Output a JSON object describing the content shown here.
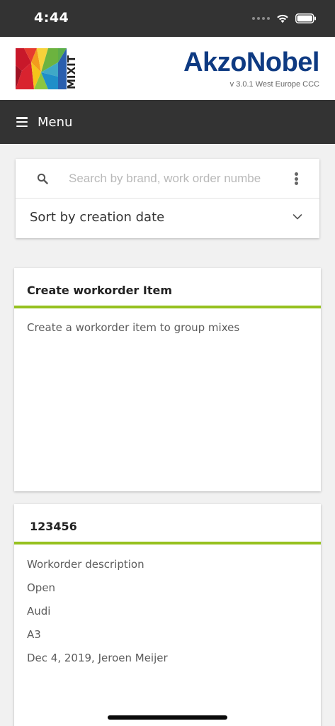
{
  "status_bar": {
    "time": "4:44"
  },
  "header": {
    "brand_logo_text": "MIXIT",
    "company_logo_text": "AkzoNobel",
    "version": "v 3.0.1 West Europe CCC"
  },
  "menu": {
    "label": "Menu"
  },
  "search": {
    "placeholder": "Search by brand, work order numbe",
    "value": "",
    "sort_label": "Sort by creation date"
  },
  "cards": [
    {
      "title": "Create workorder Item",
      "lines": [
        "Create a workorder item to group mixes"
      ]
    },
    {
      "title": "123456",
      "lines": [
        "Workorder description",
        "Open",
        "Audi",
        "A3",
        "Dec 4, 2019, Jeroen Meijer"
      ]
    }
  ],
  "colors": {
    "accent": "#96c11f",
    "dark_bar": "#333333",
    "akzo_blue": "#0e3a82",
    "background": "#f1f1f1"
  }
}
